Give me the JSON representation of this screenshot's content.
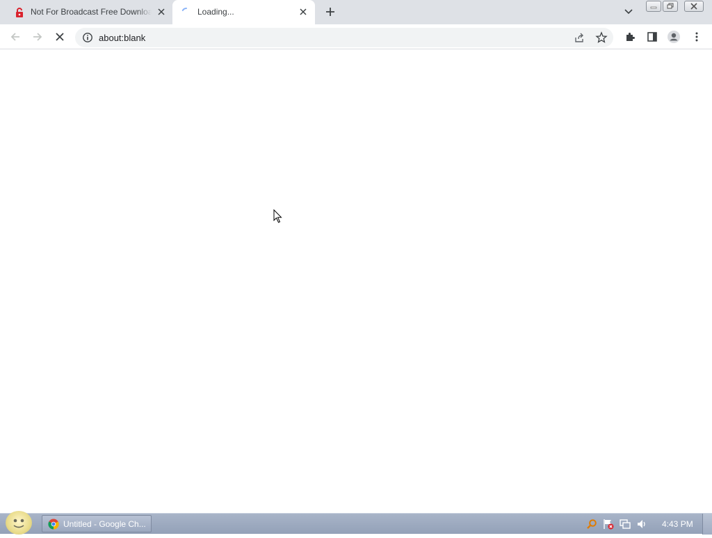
{
  "browser": {
    "tabs": [
      {
        "title": "Not For Broadcast Free Download",
        "active": false
      },
      {
        "title": "Loading...",
        "active": true
      }
    ],
    "address_bar": {
      "url": "about:blank"
    }
  },
  "taskbar": {
    "items": [
      {
        "label": "Untitled - Google Ch..."
      }
    ],
    "clock": "4:43 PM"
  },
  "colors": {
    "tabstrip_bg": "#dee1e6",
    "omnibox_bg": "#f1f3f4",
    "taskbar_bg": "#9eabc1"
  }
}
